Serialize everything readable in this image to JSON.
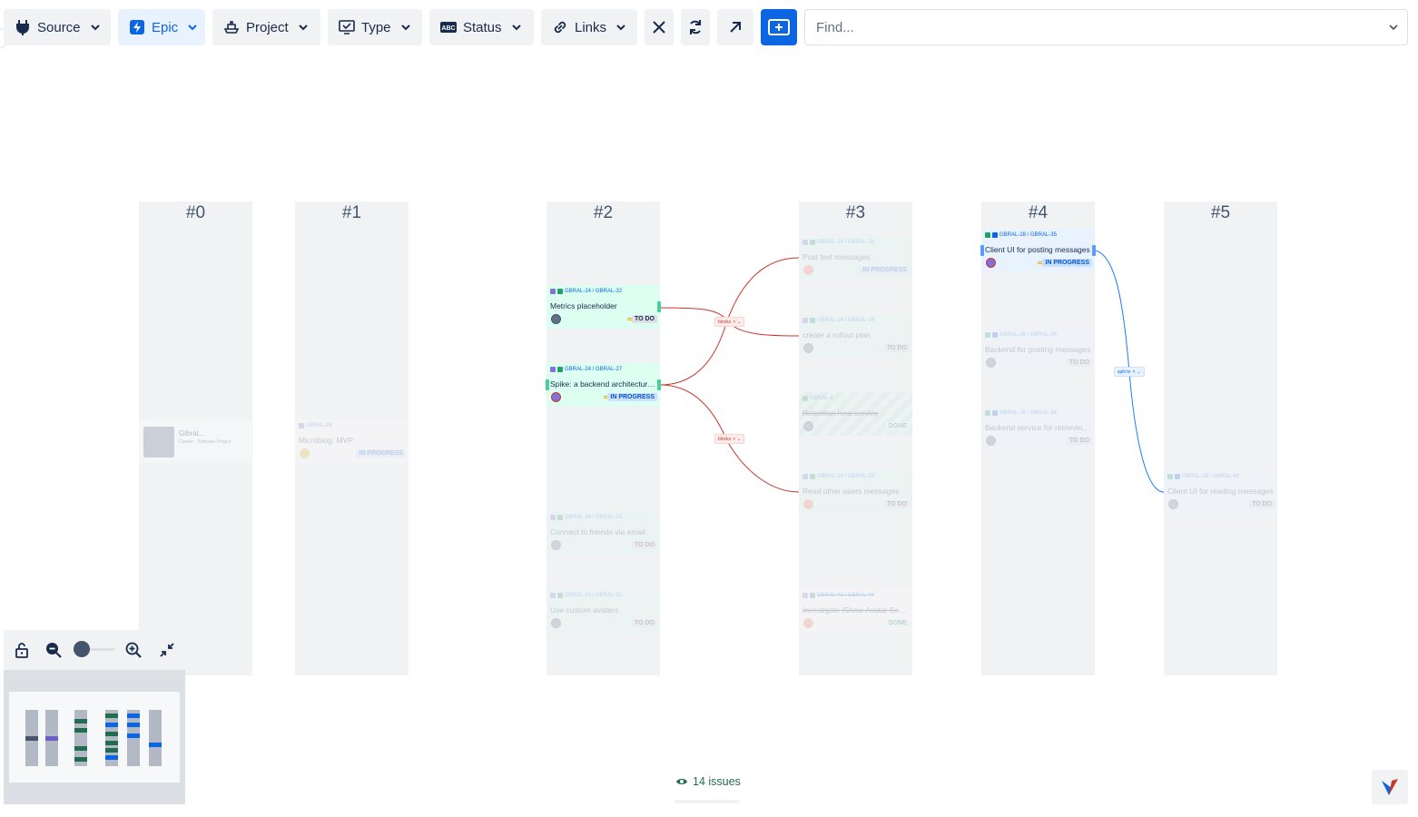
{
  "toolbar": {
    "buttons": [
      {
        "label": "Source"
      },
      {
        "label": "Epic"
      },
      {
        "label": "Project"
      },
      {
        "label": "Type"
      },
      {
        "label": "Status"
      },
      {
        "label": "Links"
      }
    ],
    "find_placeholder": "Find..."
  },
  "columns": [
    "#0",
    "#1",
    "#2",
    "#3",
    "#4",
    "#5"
  ],
  "epic": {
    "name": "Gibral...",
    "sub": "Classic · Software Project"
  },
  "cards": [
    {
      "keys": "GBRAL-24",
      "title": "Microblog: MVP",
      "status": "IN PROGRESS"
    },
    {
      "keys": "GBRAL-24 / GBRAL-32",
      "title": "Metrics placeholder",
      "status": "TO DO"
    },
    {
      "keys": "GBRAL-24 / GBRAL-27",
      "title": "Spike: a backend architecture f...",
      "status": "IN PROGRESS"
    },
    {
      "keys": "GBRAL-24 / GBRAL-33",
      "title": "Connect to friends via email",
      "status": "TO DO"
    },
    {
      "keys": "GBRAL-24 / GBRAL-31",
      "title": "Use custom avatars",
      "status": "TO DO"
    },
    {
      "keys": "GBRAL-24 / GBRAL-38",
      "title": "Post text messages",
      "status": "IN PROGRESS"
    },
    {
      "keys": "GBRAL-24 / GBRAL-16",
      "title": "create a rollout plan",
      "status": "TO DO"
    },
    {
      "keys": "GBRAL-4",
      "title": "Retention new service",
      "status": "DONE"
    },
    {
      "keys": "GBRAL-24 / GBRAL-29",
      "title": "Read other users messages",
      "status": "TO DO"
    },
    {
      "keys": "GBRAL-41 / GBRAL-46",
      "title": "Investigate IShow Avatar Servi...",
      "status": "DONE"
    },
    {
      "keys": "GBRAL-28 / GBRAL-35",
      "title": "Client UI for posting messages",
      "status": "IN PROGRESS"
    },
    {
      "keys": "GBRAL-28 / GBRAL-36",
      "title": "Backend for posting messages",
      "status": "TO DO"
    },
    {
      "keys": "GBRAL-28 / GBRAL-34",
      "title": "Backend service for retrieving...",
      "status": "TO DO"
    },
    {
      "keys": "GBRAL-28 / GBRAL-43",
      "title": "Client UI for reading messages",
      "status": "TO DO"
    }
  ],
  "links": [
    {
      "label": "blocks"
    },
    {
      "label": "blocks"
    },
    {
      "label": "split to"
    }
  ],
  "footer": {
    "issue_count": "14 issues"
  },
  "colors": {
    "accent": "#0c66e4",
    "block_link": "#c9372c",
    "split_link": "#1d7afc"
  }
}
